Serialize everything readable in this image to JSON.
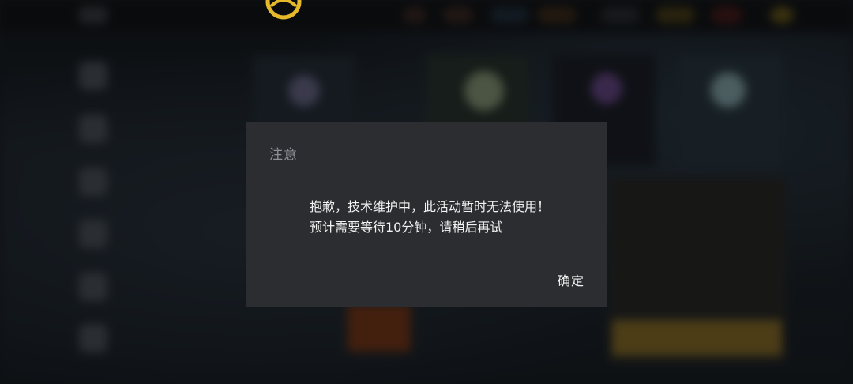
{
  "dialog": {
    "title": "注意",
    "message_line1": "抱歉，技术维护中，此活动暂时无法使用！",
    "message_line2": "预计需要等待10分钟，请稍后再试",
    "confirm_label": "确定"
  },
  "colors": {
    "dialog_background": "#2c2d31",
    "title_text": "#8e9096",
    "body_text": "#f2f2f2",
    "logo_gold": "#e6b92b"
  },
  "icons": {
    "logo": "brand-logo-icon"
  }
}
